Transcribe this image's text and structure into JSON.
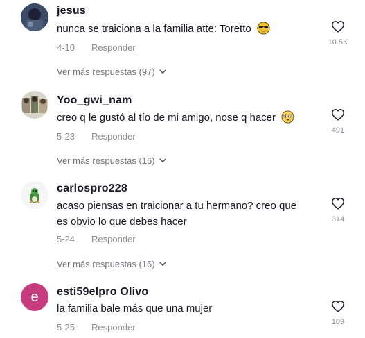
{
  "more_label_prefix": "Ver más respuestas",
  "comments": [
    {
      "username": "jesus",
      "text": "nunca se traiciona a la familia atte: Toretto",
      "text_line2": "",
      "emoji": "sunglasses-face",
      "date": "4-10",
      "reply_label": "Responder",
      "likes": "10.5K",
      "more_replies": "Ver más respuestas (97)"
    },
    {
      "username": "Yoo_gwi_nam",
      "text": "creo q le gustó al tío de mi amigo, nose q hacer",
      "text_line2": "",
      "emoji": "flushed-face",
      "date": "5-23",
      "reply_label": "Responder",
      "likes": "491",
      "more_replies": "Ver más respuestas (16)"
    },
    {
      "username": "carlospro228",
      "text": "acaso piensas en traicionar a tu hermano? creo que",
      "text_line2": "es obvio lo que debes hacer",
      "emoji": "",
      "date": "5-24",
      "reply_label": "Responder",
      "likes": "314",
      "more_replies": "Ver más respuestas (16)"
    },
    {
      "username": "esti59elpro Olivo",
      "avatar_letter": "e",
      "text": "la familia bale más que una mujer",
      "text_line2": "",
      "emoji": "",
      "date": "5-25",
      "reply_label": "Responder",
      "likes": "109",
      "more_replies": ""
    }
  ],
  "colors": {
    "primary_text": "#161823",
    "secondary_text": "#8a8b91",
    "letter_avatar_bg": "#c63a7e"
  }
}
